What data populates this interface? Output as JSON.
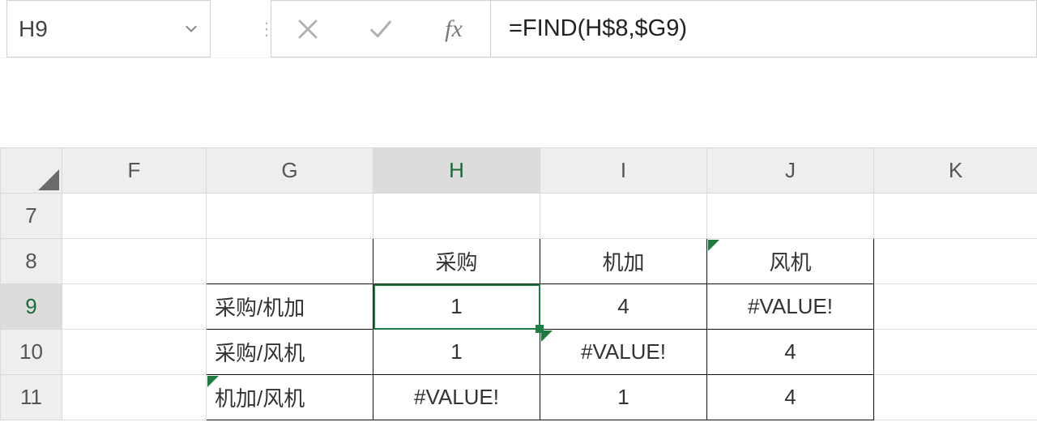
{
  "name_box": {
    "value": "H9"
  },
  "formula_bar": {
    "fx_label": "fx",
    "formula": "=FIND(H$8,$G9)"
  },
  "columns": [
    "F",
    "G",
    "H",
    "I",
    "J",
    "K"
  ],
  "active_col": "H",
  "rows": [
    "7",
    "8",
    "9",
    "10",
    "11"
  ],
  "active_row": "9",
  "active_cell": "H9",
  "cells": {
    "G8": "",
    "H8": "采购",
    "I8": "机加",
    "J8": "风机",
    "G9": "采购/机加",
    "H9": "1",
    "I9": "4",
    "J9": "#VALUE!",
    "G10": "采购/风机",
    "H10": "1",
    "I10": "#VALUE!",
    "J10": "4",
    "G11": "机加/风机",
    "H11": "#VALUE!",
    "I11": "1",
    "J11": "4"
  }
}
